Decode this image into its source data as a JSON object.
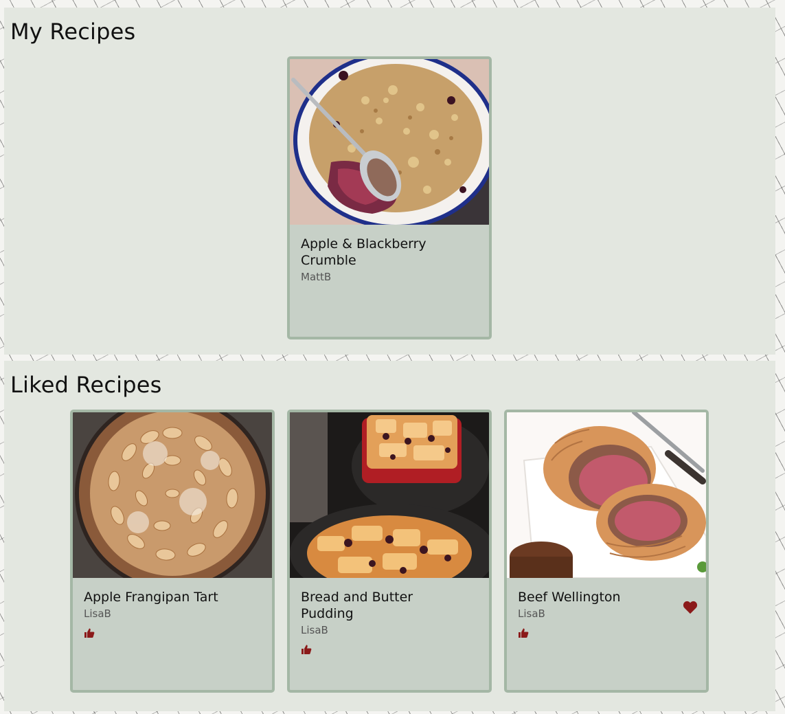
{
  "colors": {
    "section_bg": "#e3e7e0",
    "card_bg": "#c7d0c7",
    "card_border": "#a4b7a5",
    "accent_icon": "#8b1a1a"
  },
  "my_recipes": {
    "title": "My Recipes",
    "cards": [
      {
        "title": "Apple & Blackberry Crumble",
        "author": "MattB",
        "image": "apple-blackberry-crumble-photo"
      }
    ]
  },
  "liked_recipes": {
    "title": "Liked Recipes",
    "cards": [
      {
        "title": "Apple Frangipan Tart",
        "author": "LisaB",
        "image": "apple-frangipan-tart-photo",
        "like_icon": "thumbs-up-icon"
      },
      {
        "title": "Bread and Butter Pudding",
        "author": "LisaB",
        "image": "bread-butter-pudding-photo",
        "like_icon": "thumbs-up-icon"
      },
      {
        "title": "Beef Wellington",
        "author": "LisaB",
        "image": "beef-wellington-photo",
        "like_icon": "thumbs-up-icon",
        "favorite_icon": "heart-icon"
      }
    ]
  }
}
